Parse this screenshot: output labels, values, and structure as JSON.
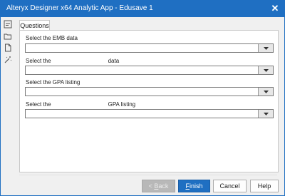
{
  "window": {
    "title": "Alteryx Designer x64 Analytic App - Edusave 1",
    "close_glyph": "✕"
  },
  "sidebar": {
    "icons": [
      "app-info-icon",
      "folder-open-icon",
      "file-icon",
      "magic-wand-icon"
    ]
  },
  "tabs": [
    {
      "label": "Questions",
      "selected": true
    }
  ],
  "questions": [
    {
      "label": "Select the EMB data",
      "value": ""
    },
    {
      "label": "Select the                                    data",
      "value": ""
    },
    {
      "label": "Select the GPA listing",
      "value": ""
    },
    {
      "label": "Select the                                    GPA listing",
      "value": ""
    }
  ],
  "buttons": {
    "back": {
      "prefix": "< ",
      "mnemonic": "B",
      "rest": "ack",
      "enabled": false
    },
    "finish": {
      "mnemonic": "F",
      "rest": "inish"
    },
    "cancel": "Cancel",
    "help": "Help"
  },
  "colors": {
    "title_bar": "#1f6fc2",
    "primary_button": "#1f6fc2",
    "disabled_button": "#b8b8b8"
  }
}
